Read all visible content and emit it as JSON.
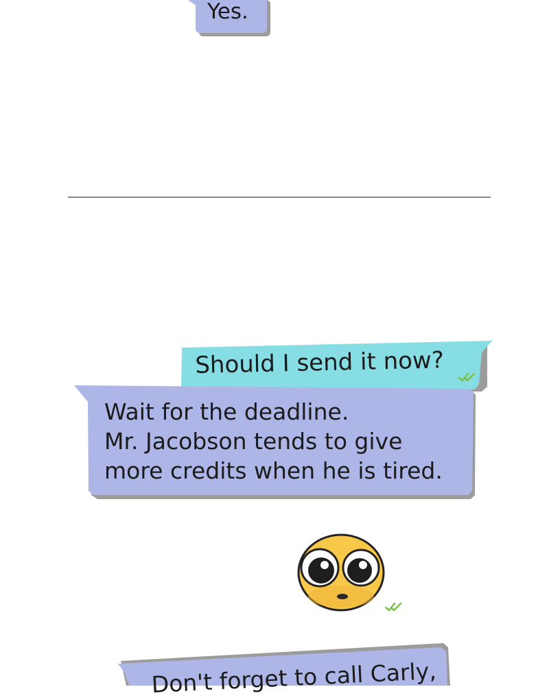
{
  "thread": {
    "messages": [
      {
        "id": "yes",
        "from": "other",
        "text": "Yes."
      },
      {
        "id": "send",
        "from": "me",
        "text": "Should I send it now?",
        "status": "read"
      },
      {
        "id": "deadline",
        "from": "other",
        "lines": [
          "Wait for the deadline.",
          "Mr. Jacobson tends to give",
          "more credits when he is tired."
        ]
      },
      {
        "id": "emoji",
        "from": "me",
        "sticker": "wide-eyed-face-icon",
        "status": "read"
      },
      {
        "id": "carly",
        "from": "other",
        "text": "Don't forget to call Carly,"
      }
    ]
  },
  "colors": {
    "bubble_other": "#adb6e6",
    "bubble_me": "#86dde4",
    "bubble_shadow": "#9c9c9c",
    "read_check": "#7cc24a",
    "emoji_face": "#f7c84a"
  }
}
